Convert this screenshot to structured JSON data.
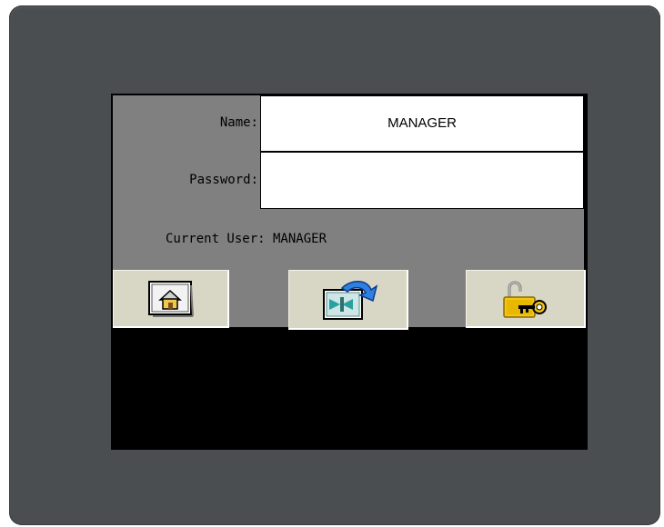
{
  "login": {
    "name_label": "Name:",
    "name_value": "MANAGER",
    "password_label": "Password:",
    "password_value": "",
    "current_user_text": "Current User: MANAGER"
  },
  "buttons": [
    {
      "icon": "home-icon"
    },
    {
      "icon": "exit-screen-icon"
    },
    {
      "icon": "unlock-key-icon"
    }
  ],
  "colors": {
    "bezel": "#4a4e50",
    "panel": "#808080",
    "button_face": "#d8d6c4",
    "screen_background": "#000000"
  }
}
